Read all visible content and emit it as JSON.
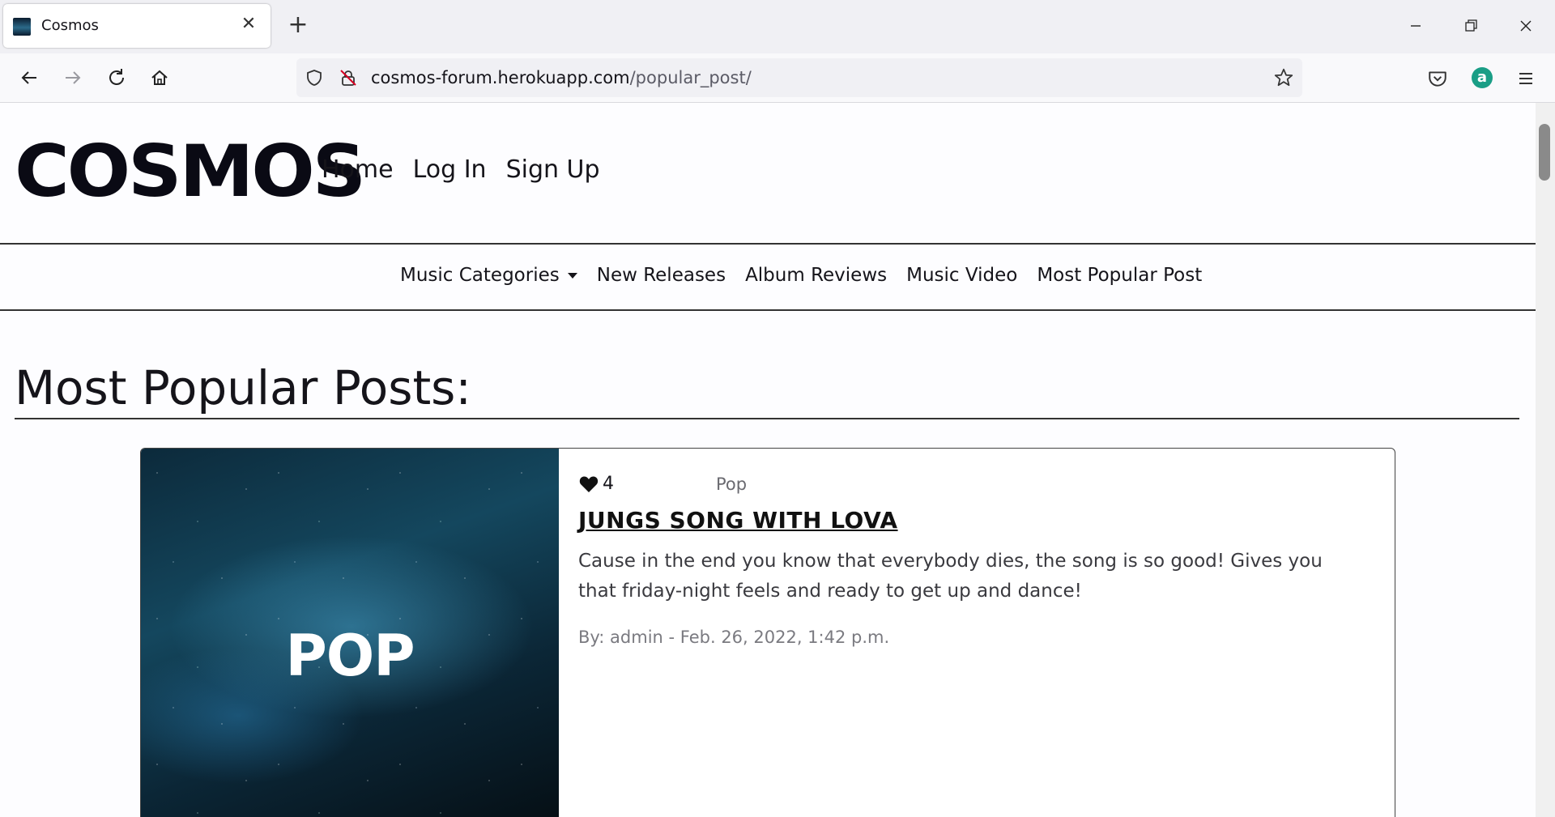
{
  "browser": {
    "tab_title": "Cosmos",
    "url_host": "cosmos-forum.herokuapp.com",
    "url_path": "/popular_post/",
    "profile_initial": "a"
  },
  "site": {
    "logo_text": "COSMOS",
    "main_nav": [
      "Home",
      "Log In",
      "Sign Up"
    ],
    "categories_nav": {
      "dropdown_label": "Music Categories",
      "links": [
        "New Releases",
        "Album Reviews",
        "Music Video",
        "Most Popular Post"
      ]
    }
  },
  "page": {
    "title": "Most Popular Posts:"
  },
  "posts": [
    {
      "image_label": "POP",
      "likes": "4",
      "category": "Pop",
      "title": "JUNGS SONG WITH LOVA",
      "excerpt": "Cause in the end you know that everybody dies, the song is so good! Gives you that friday-night feels and ready to get up and dance!",
      "byline": "By: admin - Feb. 26, 2022, 1:42 p.m."
    }
  ],
  "colors": {
    "accent_profile": "#1a9e86",
    "text": "#15141a"
  }
}
